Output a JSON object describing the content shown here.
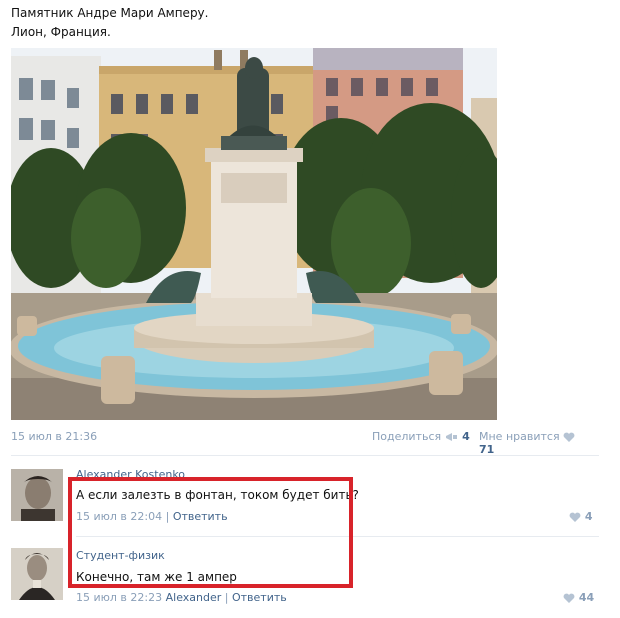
{
  "post": {
    "line1": "Памятник Андре Мари Амперу.",
    "line2": "Лион, Франция.",
    "date": "15 июл в 21:36",
    "share_label": "Поделиться",
    "share_count": "4",
    "likes_label": "Мне нравится",
    "likes_count": "71"
  },
  "comments": [
    {
      "author": "Alexander Kostenko",
      "text": "А если залезть в фонтан, током будет бить?",
      "date": "15 июл в 22:04",
      "reply": "Ответить",
      "likes": "4"
    },
    {
      "author": "Студент-физик",
      "text": "Конечно, там же 1 ампер",
      "date": "15 июл в 22:23",
      "reply_to": "Alexander",
      "reply": "Ответить",
      "likes": "44"
    }
  ],
  "colors": {
    "link": "#42648b",
    "meta": "#8a9fb8",
    "highlight_border": "#d8232a"
  }
}
